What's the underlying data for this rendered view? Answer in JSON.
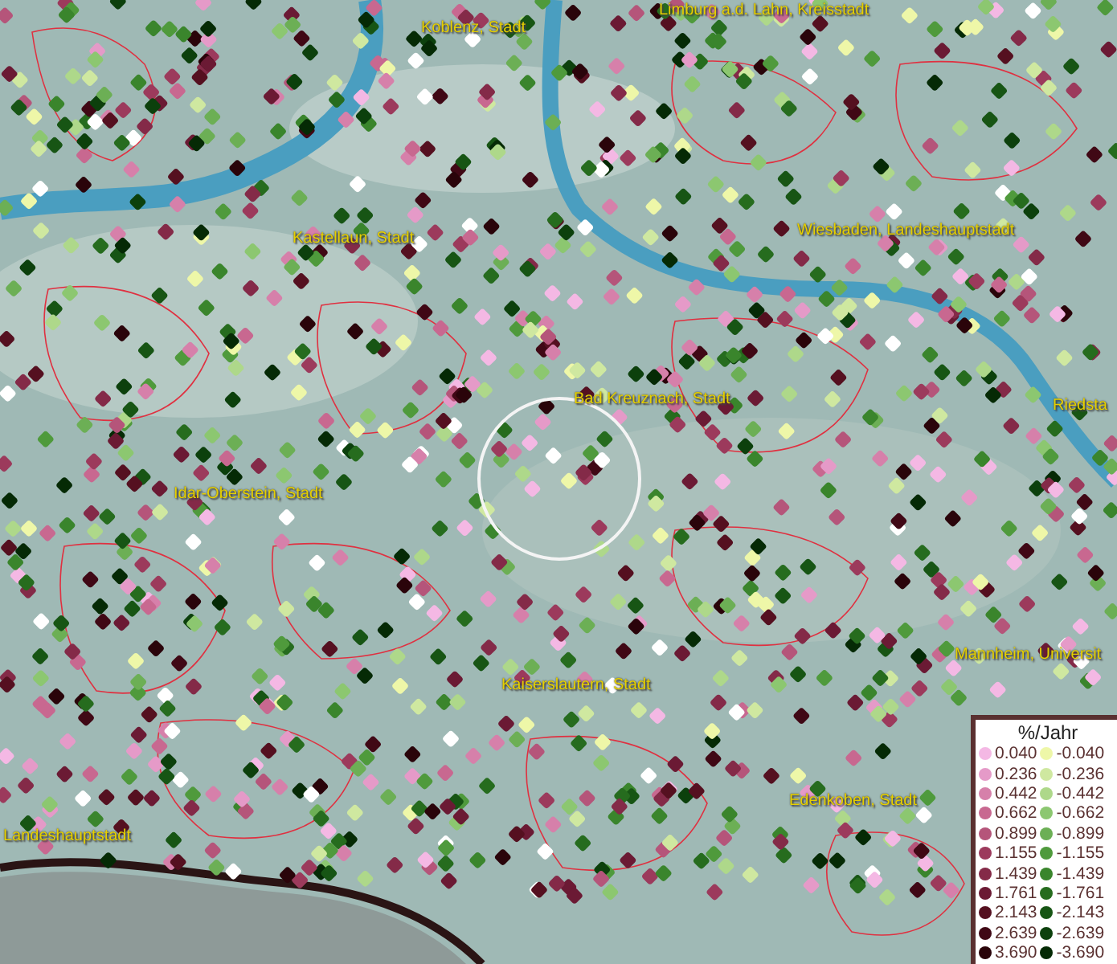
{
  "map": {
    "place_labels": [
      "Limburg a.d. Lahn, Kreisstadt",
      "Koblenz, Stadt",
      "Kastellaun, Stadt",
      "Wiesbaden, Landeshauptstadt",
      "Bad Kreuznach, Stadt",
      "Riedsta",
      "Idar-Oberstein, Stadt",
      "Mannheim, Universit",
      "Kaiserslautern, Stadt",
      "Edenkoben, Stadt",
      "Landeshauptstadt"
    ]
  },
  "legend": {
    "title": "%/Jahr",
    "positive_classes": [
      {
        "value": "0.040",
        "color": "#f4b8e4"
      },
      {
        "value": "0.236",
        "color": "#e59ac8"
      },
      {
        "value": "0.442",
        "color": "#d680aa"
      },
      {
        "value": "0.662",
        "color": "#c86890"
      },
      {
        "value": "0.899",
        "color": "#b5557a"
      },
      {
        "value": "1.155",
        "color": "#9c3a5c"
      },
      {
        "value": "1.439",
        "color": "#842a48"
      },
      {
        "value": "1.761",
        "color": "#6b1a34"
      },
      {
        "value": "2.143",
        "color": "#551020"
      },
      {
        "value": "2.639",
        "color": "#400815"
      },
      {
        "value": "3.690",
        "color": "#2a040a"
      }
    ],
    "negative_classes": [
      {
        "value": "-0.040",
        "color": "#eef7a8"
      },
      {
        "value": "-0.236",
        "color": "#cfe8a0"
      },
      {
        "value": "-0.442",
        "color": "#aed88a"
      },
      {
        "value": "-0.662",
        "color": "#8cc770"
      },
      {
        "value": "-0.899",
        "color": "#6caf55"
      },
      {
        "value": "-1.155",
        "color": "#4f9a3c"
      },
      {
        "value": "-1.439",
        "color": "#3a852c"
      },
      {
        "value": "-1.761",
        "color": "#266c1e"
      },
      {
        "value": "-2.143",
        "color": "#175514"
      },
      {
        "value": "-2.639",
        "color": "#0c400c"
      },
      {
        "value": "-3.690",
        "color": "#052a05"
      }
    ]
  }
}
